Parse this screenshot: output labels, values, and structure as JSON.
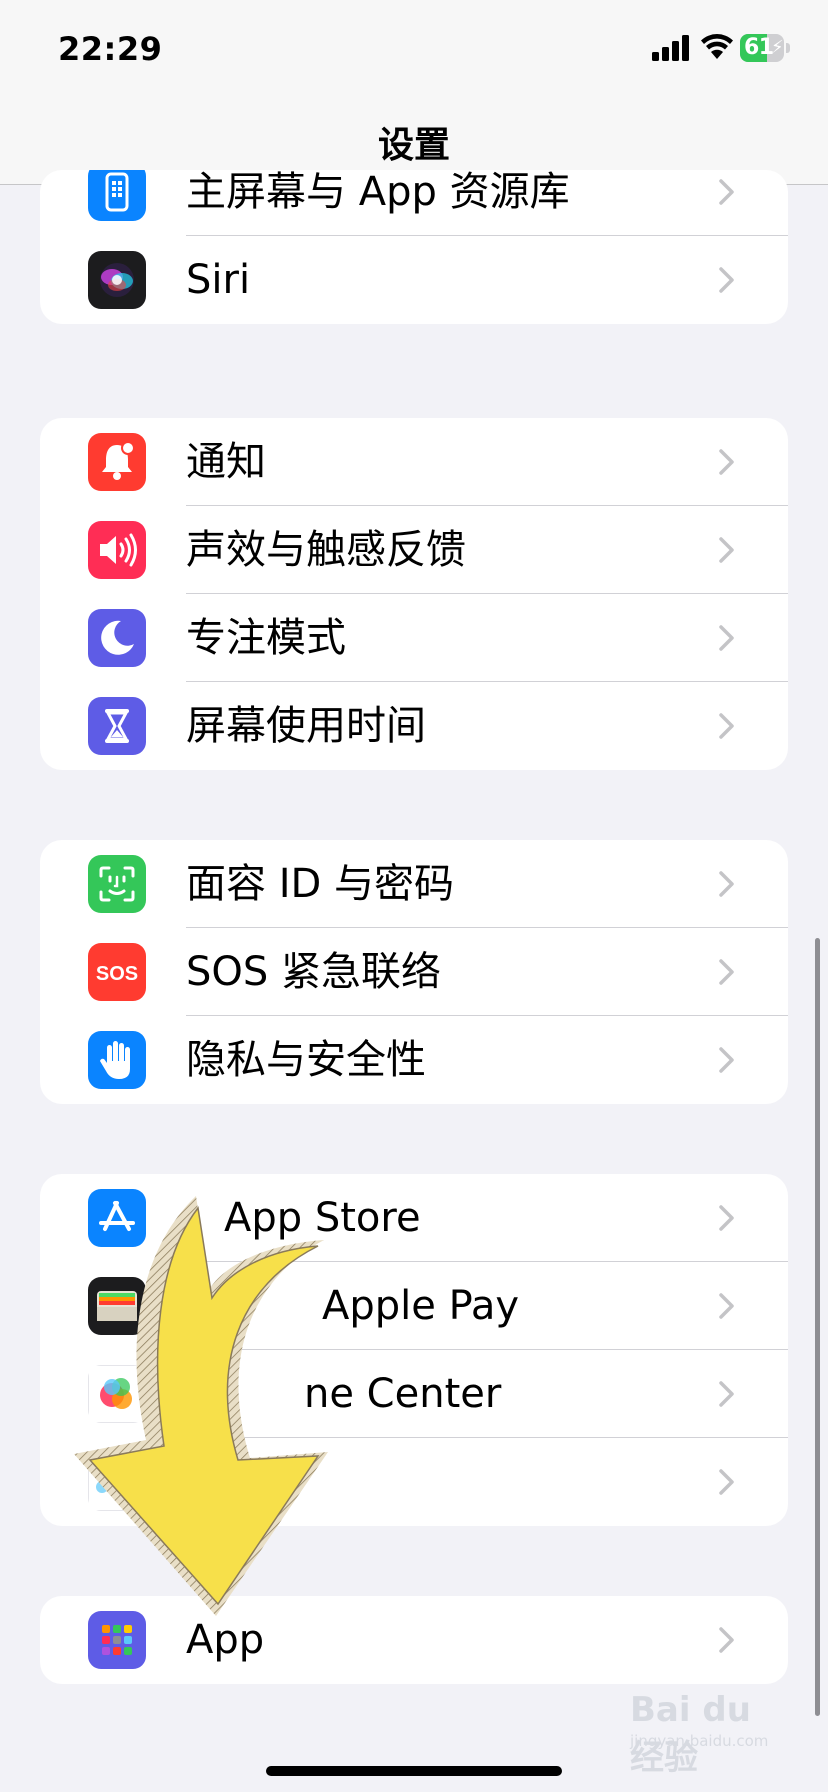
{
  "status_bar": {
    "time": "22:29",
    "battery_level": "61",
    "battery_fraction": 0.61,
    "battery_color": "#34c759"
  },
  "nav": {
    "title": "设置"
  },
  "groups": [
    {
      "items": [
        {
          "label": "主屏幕与 App 资源库",
          "icon": "home-screen-icon",
          "icon_color": "#0a84ff"
        },
        {
          "label": "Siri",
          "icon": "siri-icon",
          "icon_color": "#1c1c1e"
        }
      ]
    },
    {
      "items": [
        {
          "label": "通知",
          "icon": "bell-icon",
          "icon_color": "#ff3b30"
        },
        {
          "label": "声效与触感反馈",
          "icon": "speaker-icon",
          "icon_color": "#ff2d55"
        },
        {
          "label": "专注模式",
          "icon": "moon-icon",
          "icon_color": "#5e5ce6"
        },
        {
          "label": "屏幕使用时间",
          "icon": "hourglass-icon",
          "icon_color": "#5e5ce6"
        }
      ]
    },
    {
      "items": [
        {
          "label": "面容 ID 与密码",
          "icon": "face-id-icon",
          "icon_color": "#34c759"
        },
        {
          "label": "SOS 紧急联络",
          "icon": "sos-icon",
          "icon_color": "#ff3b30",
          "icon_text": "SOS"
        },
        {
          "label": "隐私与安全性",
          "icon": "hand-icon",
          "icon_color": "#0a84ff"
        }
      ]
    },
    {
      "items": [
        {
          "label": "App Store",
          "icon": "app-store-icon",
          "icon_color": "#0a84ff"
        },
        {
          "label": "Apple Pay",
          "icon": "wallet-icon",
          "icon_color": "#1c1c1e"
        },
        {
          "label": "ne Center",
          "icon": "game-center-icon",
          "icon_color": "#ffffff"
        },
        {
          "label": "",
          "icon": "passwords-icon",
          "icon_color": "#ffffff"
        }
      ]
    },
    {
      "items": [
        {
          "label": "App",
          "icon": "apps-grid-icon",
          "icon_color": "#5e5ce6"
        }
      ]
    }
  ],
  "overlay": {
    "arrow_color": "#f7e04a"
  },
  "watermark": {
    "logo_text": "Bai du 经验",
    "site_text": "jingyan.baidu.com"
  }
}
